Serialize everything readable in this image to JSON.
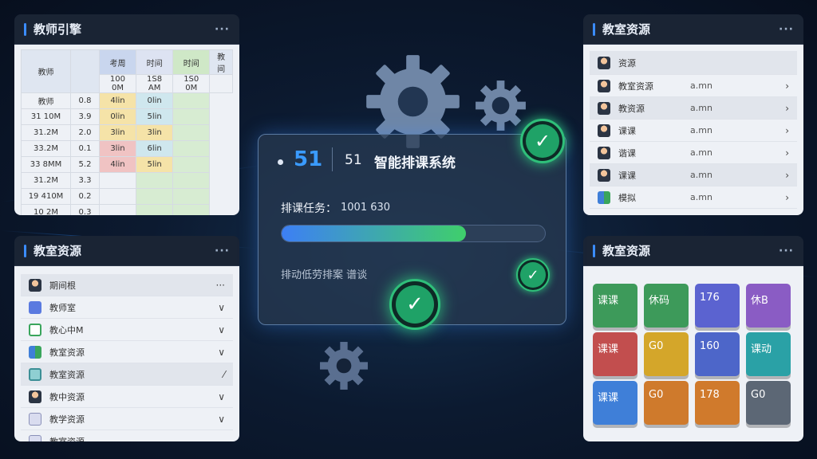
{
  "colors": {
    "accent": "#3b8cff",
    "check": "#1fa267",
    "progress_start": "#3d7ff5",
    "progress_end": "#3fcf6b"
  },
  "schedule_panel": {
    "title": "教师引擎",
    "more": "···",
    "headers_top": [
      "教师",
      "",
      "考周",
      "时间",
      "时间",
      "教间"
    ],
    "headers_sub": [
      "",
      "",
      "100 0M",
      "1S8 AM",
      "1S0 0M",
      ""
    ],
    "rows": [
      {
        "name": "教师",
        "v": "0.8",
        "a": "4lin",
        "b": "0lin"
      },
      {
        "name": "31 10M",
        "v": "3.9",
        "a": "0lin",
        "b": "5lin"
      },
      {
        "name": "31.2M",
        "v": "2.0",
        "a": "3lin",
        "b": "3lin"
      },
      {
        "name": "33.2M",
        "v": "0.1",
        "a": "3lin",
        "b": "6lin"
      },
      {
        "name": "33 8MM",
        "v": "5.2",
        "a": "4lin",
        "b": "5lin"
      },
      {
        "name": "31.2M",
        "v": "3.3",
        "a": "",
        "b": ""
      },
      {
        "name": "19 410M",
        "v": "0.2",
        "a": "",
        "b": ""
      },
      {
        "name": "10 2M",
        "v": "0.3",
        "a": "",
        "b": ""
      }
    ]
  },
  "left_resources": {
    "title": "教室资源",
    "more": "···",
    "items": [
      {
        "label": "期间根",
        "tail": "···",
        "icon": "avatar-icon"
      },
      {
        "label": "教师室",
        "tail": "∨",
        "icon": "music-icon"
      },
      {
        "label": "教心中M",
        "tail": "∨",
        "icon": "room-icon"
      },
      {
        "label": "教室资源",
        "tail": "∨",
        "icon": "group-icon"
      },
      {
        "label": "教室资源",
        "tail": "⁄",
        "icon": "board-icon"
      },
      {
        "label": "教中资源",
        "tail": "∨",
        "icon": "person-icon"
      },
      {
        "label": "教学资源",
        "tail": "∨",
        "icon": "doc-icon"
      },
      {
        "label": "教室资源",
        "tail": "",
        "icon": "doc-icon"
      }
    ]
  },
  "right_resources": {
    "title": "教室资源",
    "more": "···",
    "header_label": "资源",
    "items": [
      {
        "label": "教室资源",
        "value": "a.mn",
        "tail": "›"
      },
      {
        "label": "教资源",
        "value": "a.mn",
        "tail": "›"
      },
      {
        "label": "课课",
        "value": "a.mn",
        "tail": "›"
      },
      {
        "label": "谐课",
        "value": "a.mn",
        "tail": "›"
      },
      {
        "label": "课课",
        "value": "a.mn",
        "tail": "›"
      },
      {
        "label": "模拟",
        "value": "a.mn",
        "tail": "›"
      }
    ]
  },
  "tiles_panel": {
    "title": "教室资源",
    "more": "···",
    "tiles": [
      {
        "text": "课课",
        "color": "#3d9a5a"
      },
      {
        "text": "休码",
        "color": "#3d9a5a"
      },
      {
        "text": "176",
        "color": "#5b63d0"
      },
      {
        "text": "休B",
        "color": "#8a5cc4"
      },
      {
        "text": "课课",
        "color": "#c24e4e"
      },
      {
        "text": "G0",
        "color": "#d4a62a"
      },
      {
        "text": "160",
        "color": "#4d66c9"
      },
      {
        "text": "课动",
        "color": "#2aa1a6"
      },
      {
        "text": "课课",
        "color": "#3f7fd8"
      },
      {
        "text": "G0",
        "color": "#cf7a2c"
      },
      {
        "text": "178",
        "color": "#d07a2c"
      },
      {
        "text": "G0",
        "color": "#5c6775"
      }
    ]
  },
  "center_card": {
    "badge_number": "51",
    "title_number": "51",
    "title": "智能排课系统",
    "task_label": "排课任务：",
    "task_value": "1001 630",
    "progress": 0.7,
    "status_text": "排动低劳排案 谱谈"
  }
}
